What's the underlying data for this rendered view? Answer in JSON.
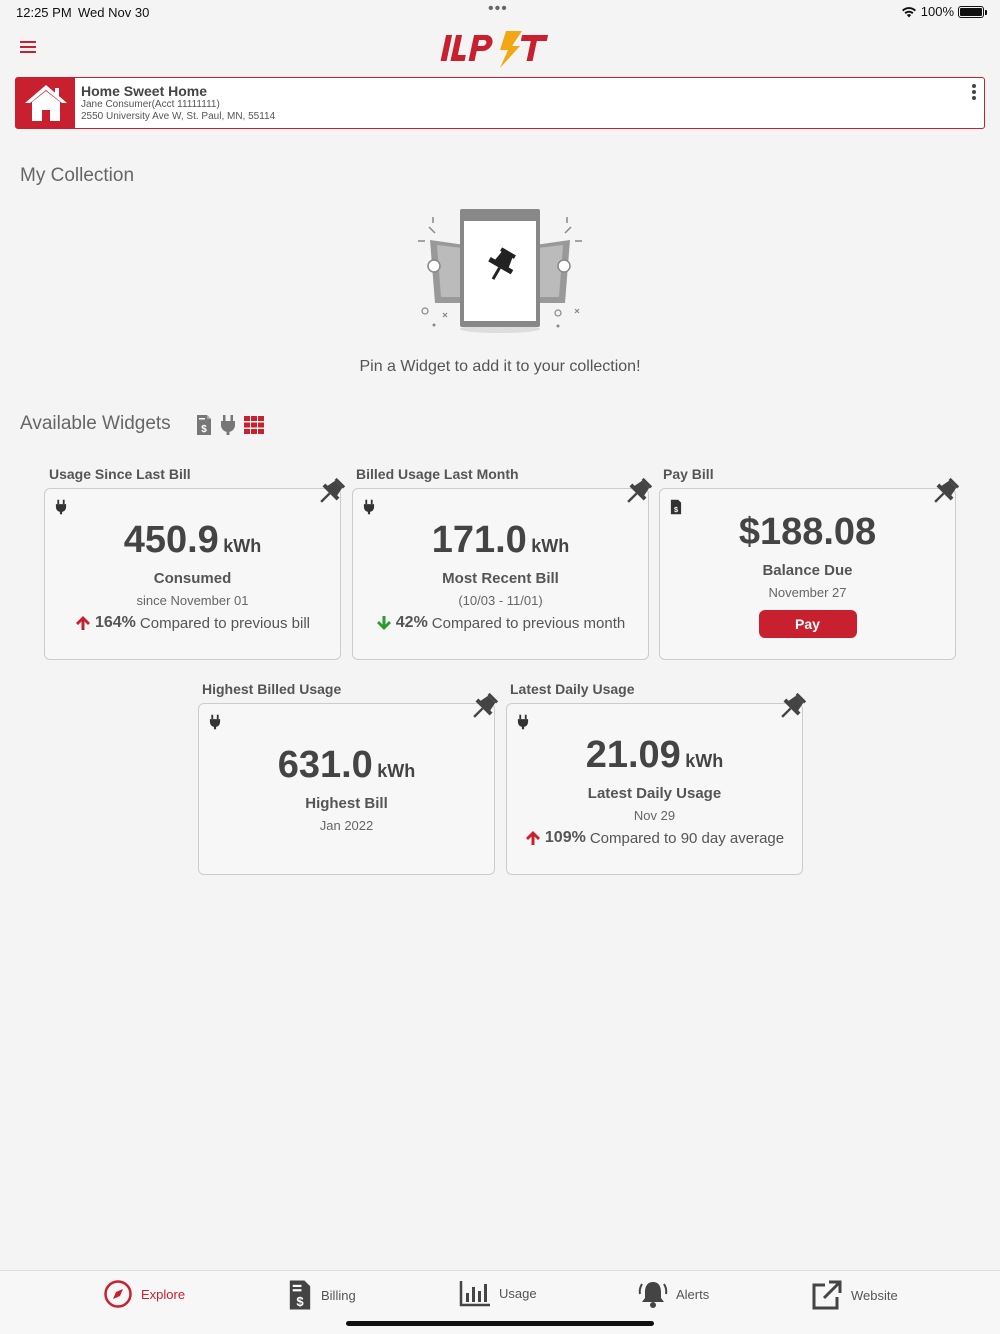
{
  "status_bar": {
    "time": "12:25 PM",
    "date": "Wed Nov 30",
    "battery": "100%"
  },
  "brand": {
    "logo_text": "ILPLT",
    "accent": "#c8202f",
    "bolt": "#f3a712"
  },
  "account": {
    "name": "Home Sweet Home",
    "holder": "Jane Consumer(Acct 11111111)",
    "address": "2550 University Ave W, St. Paul, MN, 55114"
  },
  "collection": {
    "title": "My Collection",
    "empty_message": "Pin a Widget to add it to your collection!"
  },
  "available": {
    "title": "Available Widgets",
    "filters": [
      "bill-icon",
      "plug-icon",
      "grid-icon"
    ]
  },
  "widgets": {
    "usage_since_last_bill": {
      "label": "Usage Since Last Bill",
      "value": "450.9",
      "unit": "kWh",
      "subtitle": "Consumed",
      "detail": "since November 01",
      "pct": "164%",
      "comparison": "Compared to previous bill",
      "trend": "up"
    },
    "billed_usage_last_month": {
      "label": "Billed Usage Last Month",
      "value": "171.0",
      "unit": "kWh",
      "subtitle": "Most Recent Bill",
      "detail": "(10/03 - 11/01)",
      "pct": "42%",
      "comparison": "Compared to previous month",
      "trend": "down"
    },
    "pay_bill": {
      "label": "Pay Bill",
      "amount": "$188.08",
      "subtitle": "Balance Due",
      "detail": "November 27",
      "button": "Pay"
    },
    "highest_billed_usage": {
      "label": "Highest Billed Usage",
      "value": "631.0",
      "unit": "kWh",
      "subtitle": "Highest Bill",
      "detail": "Jan 2022"
    },
    "latest_daily_usage": {
      "label": "Latest Daily Usage",
      "value": "21.09",
      "unit": "kWh",
      "subtitle": "Latest Daily Usage",
      "detail": "Nov 29",
      "pct": "109%",
      "comparison": "Compared to 90 day average",
      "trend": "up"
    }
  },
  "nav": [
    {
      "label": "Explore",
      "icon": "compass-icon",
      "active": true
    },
    {
      "label": "Billing",
      "icon": "bill-icon",
      "active": false
    },
    {
      "label": "Usage",
      "icon": "bar-chart-icon",
      "active": false
    },
    {
      "label": "Alerts",
      "icon": "bell-icon",
      "active": false
    },
    {
      "label": "Website",
      "icon": "external-link-icon",
      "active": false
    }
  ]
}
